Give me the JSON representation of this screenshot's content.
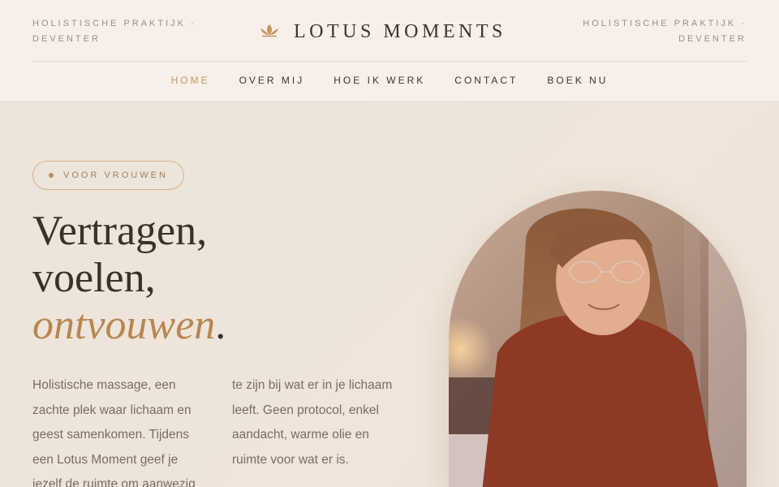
{
  "header": {
    "tagline_left": "HOLISTISCHE PRAKTIJK · DEVENTER",
    "tagline_right": "HOLISTISCHE PRAKTIJK · DEVENTER",
    "brand": "LOTUS MOMENTS",
    "logo_icon": "lotus-icon"
  },
  "nav": {
    "items": [
      {
        "label": "HOME",
        "active": true
      },
      {
        "label": "OVER MIJ",
        "active": false
      },
      {
        "label": "HOE IK WERK",
        "active": false
      },
      {
        "label": "CONTACT",
        "active": false
      },
      {
        "label": "BOEK NU",
        "active": false
      }
    ]
  },
  "hero": {
    "badge": "VOOR VROUWEN",
    "headline_line1": "Vertragen,",
    "headline_line2": "voelen,",
    "headline_accent": "ontvouwen",
    "headline_end": ".",
    "intro": "Holistische massage, een zachte plek waar lichaam en geest samenkomen. Tijdens een Lotus Moment geef je jezelf de ruimte om aanwezig te zijn bij wat er in je lichaam leeft. Geen protocol, enkel aandacht, warme olie en ruimte voor wat er is."
  },
  "colors": {
    "accent": "#c49660",
    "header_bg": "#f7efe9",
    "hero_bg": "#ece5dc",
    "text_dark": "#3a312b",
    "text_muted": "#7a6c62"
  }
}
